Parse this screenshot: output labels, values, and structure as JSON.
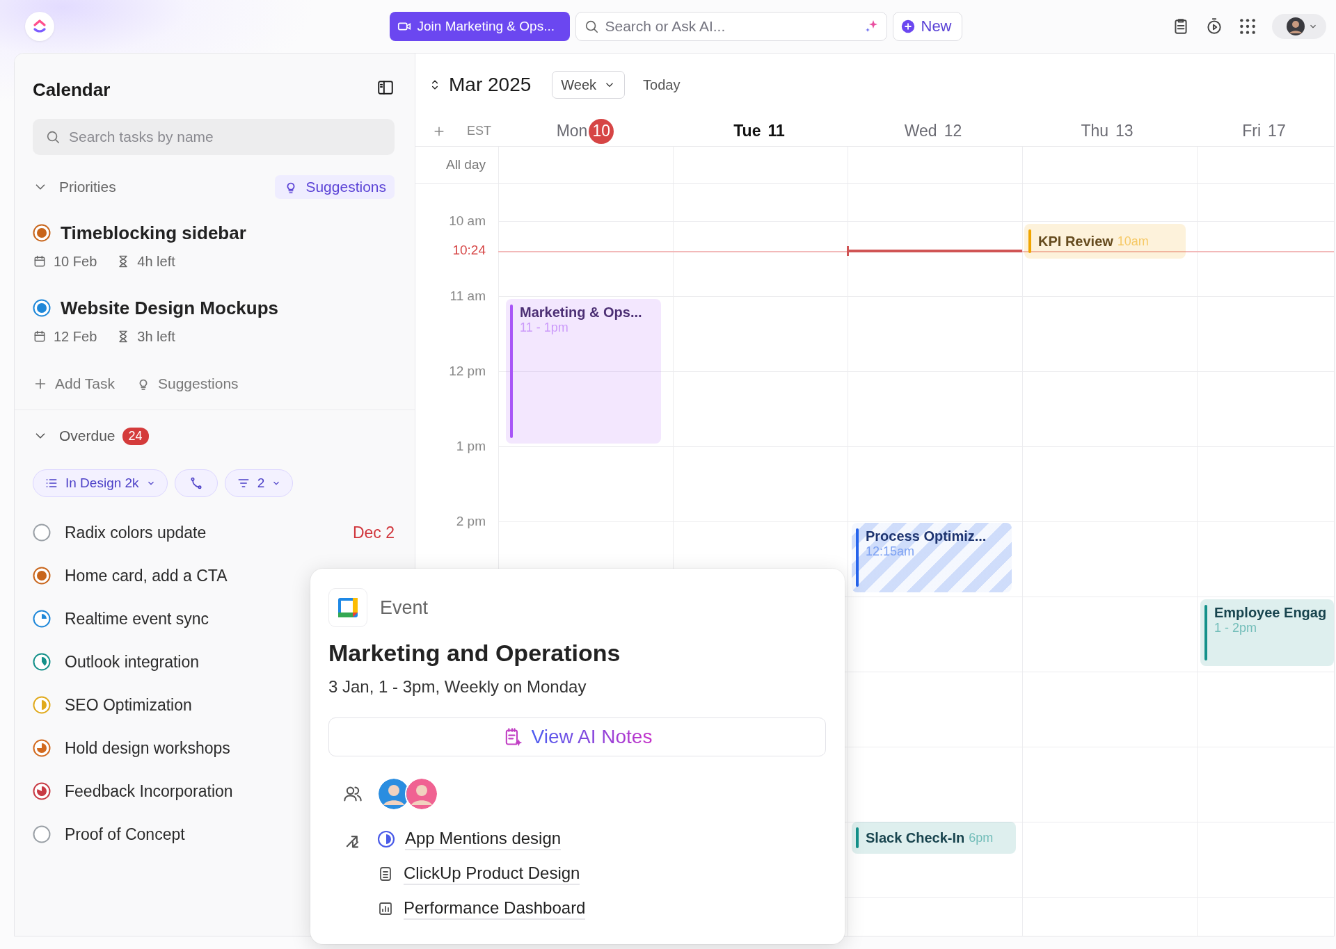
{
  "top_bar": {
    "join_button": "Join Marketing & Ops...",
    "search": {
      "placeholder": "Search or Ask AI..."
    },
    "new_button": "New"
  },
  "sidebar": {
    "title": "Calendar",
    "search": {
      "placeholder": "Search tasks by name"
    },
    "priorities": {
      "label": "Priorities",
      "expanded": true,
      "suggestions_button": "Suggestions",
      "tasks": [
        {
          "title": "Timeblocking sidebar",
          "status": {
            "kind": "dot",
            "color": "#c8651b"
          },
          "date": "10 Feb",
          "time_left": "4h left"
        },
        {
          "title": "Website Design Mockups",
          "status": {
            "kind": "dot",
            "color": "#1f88d9"
          },
          "date": "12 Feb",
          "time_left": "3h left"
        }
      ]
    },
    "add_task": "Add Task",
    "suggestions_link": "Suggestions",
    "overdue": {
      "label": "Overdue",
      "expanded": true,
      "count": "24",
      "filters": [
        {
          "kind": "list",
          "label": "In Design 2k"
        },
        {
          "kind": "route"
        },
        {
          "kind": "filter",
          "label": "2"
        }
      ],
      "tasks": [
        {
          "title": "Radix colors update",
          "status": {
            "kind": "todo",
            "color": "#9aa0a6"
          },
          "due": "Dec 2"
        },
        {
          "title": "Home card, add a CTA",
          "status": {
            "kind": "dot",
            "color": "#c8651b"
          }
        },
        {
          "title": "Realtime event sync",
          "status": {
            "kind": "quarter",
            "color": "#1f88d9"
          }
        },
        {
          "title": "Outlook integration",
          "status": {
            "kind": "third",
            "color": "#14918a"
          }
        },
        {
          "title": "SEO Optimization",
          "status": {
            "kind": "half",
            "color": "#e0a91a"
          }
        },
        {
          "title": "Hold design workshops",
          "status": {
            "kind": "three_quarters",
            "color": "#d26a1f"
          }
        },
        {
          "title": "Feedback Incorporation",
          "status": {
            "kind": "most",
            "color": "#c83a44"
          }
        },
        {
          "title": "Proof of Concept",
          "status": {
            "kind": "todo",
            "color": "#9aa0a6"
          }
        }
      ]
    }
  },
  "calendar": {
    "month": "Mar 2025",
    "view": "Week",
    "today_button": "Today",
    "timezone": "EST",
    "all_day_label": "All day",
    "hours": [
      "10 am",
      "11 am",
      "12 pm",
      "1 pm",
      "2 pm"
    ],
    "now_label": "10:24",
    "days": [
      {
        "name": "Mon",
        "date": "10",
        "today": true,
        "selected": false,
        "now_marker": false,
        "events": [
          {
            "kind": "block",
            "title": "Marketing & Ops...",
            "time": "11 - 1pm",
            "color": "#a855f7",
            "striped": false
          }
        ]
      },
      {
        "name": "Tue",
        "date": "11",
        "today": false,
        "selected": true,
        "now_marker": false
      },
      {
        "name": "Wed",
        "date": "12",
        "today": false,
        "selected": false,
        "now_marker": true,
        "events": [
          {
            "kind": "block",
            "title": "Process Optimiz...",
            "time": "12:15am",
            "color": "#2563eb",
            "striped": true
          },
          {
            "kind": "inline",
            "title": "Slack Check-In",
            "time": "6pm",
            "color": "#14918a",
            "striped": false
          }
        ]
      },
      {
        "name": "Thu",
        "date": "13",
        "today": false,
        "selected": false,
        "now_marker": false,
        "events": [
          {
            "kind": "inline",
            "title": "KPI Review",
            "time": "10am",
            "color": "#f0a500",
            "striped": false
          }
        ]
      },
      {
        "name": "Fri",
        "date": "17",
        "today": false,
        "selected": false,
        "now_marker": false,
        "events": [
          {
            "kind": "block",
            "title": "Employee Engag",
            "time": "1 - 2pm",
            "color": "#14918a",
            "striped": false
          }
        ]
      }
    ]
  },
  "event_popup": {
    "type_label": "Event",
    "title": "Marketing and Operations",
    "schedule": "3 Jan, 1 - 3pm, Weekly on Monday",
    "notes_button": "View AI Notes",
    "attendees": [
      {
        "color": "#2a8de0"
      },
      {
        "color": "#f06292"
      }
    ],
    "links": [
      {
        "kind": "task",
        "title": "App Mentions design"
      },
      {
        "kind": "doc",
        "title": "ClickUp Product Design"
      },
      {
        "kind": "dashboard",
        "title": "Performance Dashboard"
      }
    ]
  }
}
